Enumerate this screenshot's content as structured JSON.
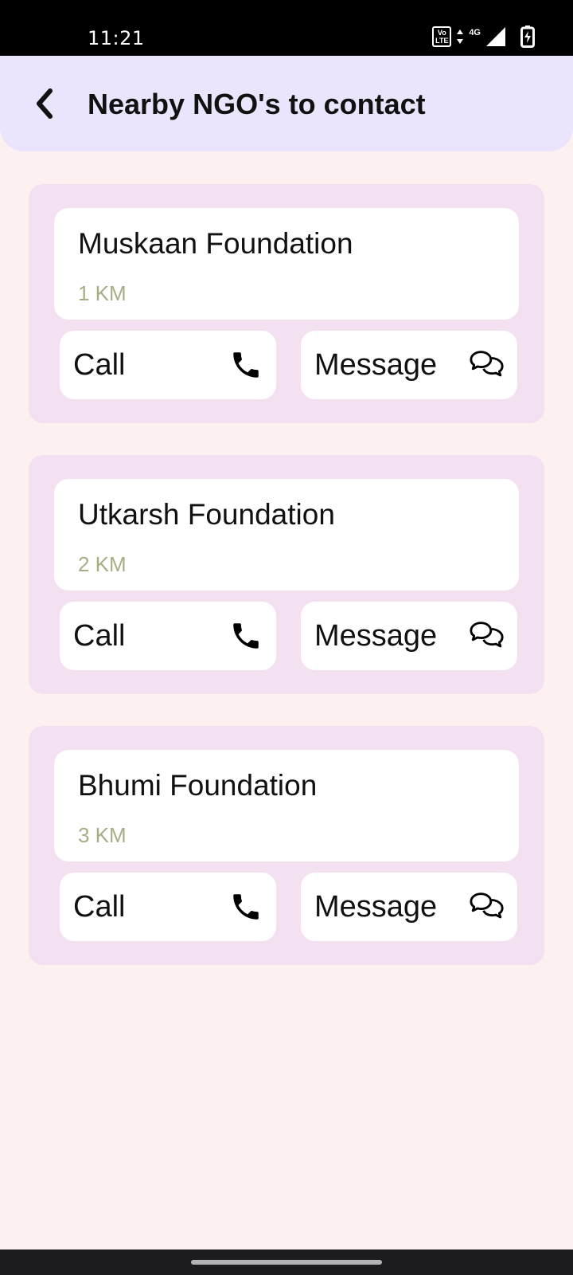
{
  "status_bar": {
    "time": "11:21",
    "network_label": "4G",
    "volte_line1": "Vo",
    "volte_line2": "LTE",
    "icons": [
      "volte-icon",
      "data-arrows-icon",
      "signal-icon",
      "battery-charging-icon"
    ]
  },
  "header": {
    "title": "Nearby NGO's to contact",
    "back_icon": "chevron-left-icon"
  },
  "ngos": [
    {
      "name": "Muskaan Foundation",
      "distance": "1 KM",
      "call_label": "Call",
      "message_label": "Message"
    },
    {
      "name": "Utkarsh Foundation",
      "distance": "2 KM",
      "call_label": "Call",
      "message_label": "Message"
    },
    {
      "name": "Bhumi Foundation",
      "distance": "3 KM",
      "call_label": "Call",
      "message_label": "Message"
    }
  ],
  "colors": {
    "background": "#fdf0f0",
    "header_bg": "#eae4fd",
    "card_bg": "#f3e0f0",
    "surface": "#ffffff",
    "distance_text": "#a9ad86",
    "status_bar_bg": "#000000",
    "nav_bar_bg": "#1c1b1f"
  }
}
